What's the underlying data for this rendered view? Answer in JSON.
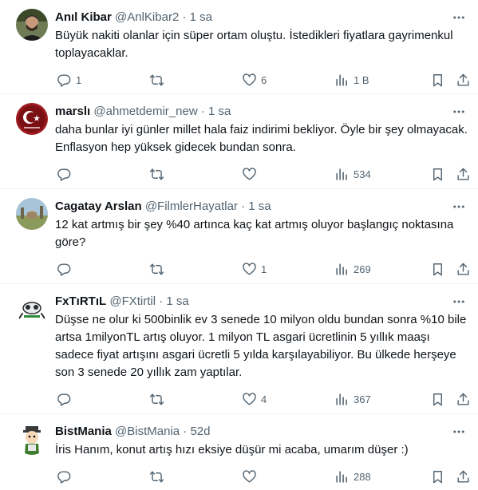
{
  "tweets": [
    {
      "name": "Anıl Kibar",
      "handle": "@AnlKibar2",
      "dot": "·",
      "time": "1 sa",
      "text": "Büyük nakiti olanlar için süper ortam oluştu. İstedikleri fiyatlara gayrimenkul toplayacaklar.",
      "replies": "1",
      "retweets": "",
      "likes": "6",
      "views": "1 B"
    },
    {
      "name": "marslı",
      "handle": "@ahmetdemir_new",
      "dot": "·",
      "time": "1 sa",
      "text": "daha bunlar iyi günler millet hala faiz indirimi bekliyor. Öyle bir şey olmayacak. Enflasyon hep yüksek gidecek bundan sonra.",
      "replies": "",
      "retweets": "",
      "likes": "",
      "views": "534"
    },
    {
      "name": "Cagatay Arslan",
      "handle": "@FilmlerHayatlar",
      "dot": "·",
      "time": "1 sa",
      "text": "12 kat artmış bir şey %40 artınca kaç kat artmış oluyor başlangıç noktasına göre?",
      "replies": "",
      "retweets": "",
      "likes": "1",
      "views": "269"
    },
    {
      "name": "FxTıRTıL",
      "handle": "@FXtirtil",
      "dot": "·",
      "time": "1 sa",
      "text": "Düşse ne olur ki 500binlik ev 3 senede 10 milyon oldu bundan sonra %10 bile artsa 1milyonTL artış oluyor. 1 milyon TL asgari ücretlinin 5 yıllık maaşı sadece fiyat artışını asgari ücretli 5 yılda karşılayabiliyor. Bu ülkede herşeye son 3 senede 20 yıllık zam yaptılar.",
      "replies": "",
      "retweets": "",
      "likes": "4",
      "views": "367"
    },
    {
      "name": "BistMania",
      "handle": "@BistMania",
      "dot": "·",
      "time": "52d",
      "text": "İris Hanım, konut artış hızı eksiye düşür mi acaba, umarım düşer :)",
      "replies": "",
      "retweets": "",
      "likes": "",
      "views": "288"
    }
  ],
  "icons": {
    "reply": "reply-icon",
    "retweet": "retweet-icon",
    "like": "heart-icon",
    "views": "views-icon",
    "bookmark": "bookmark-icon",
    "share": "share-icon",
    "more": "more-icon"
  },
  "colors": {
    "text": "#0f1419",
    "secondary": "#536471",
    "border": "#eff3f4"
  }
}
